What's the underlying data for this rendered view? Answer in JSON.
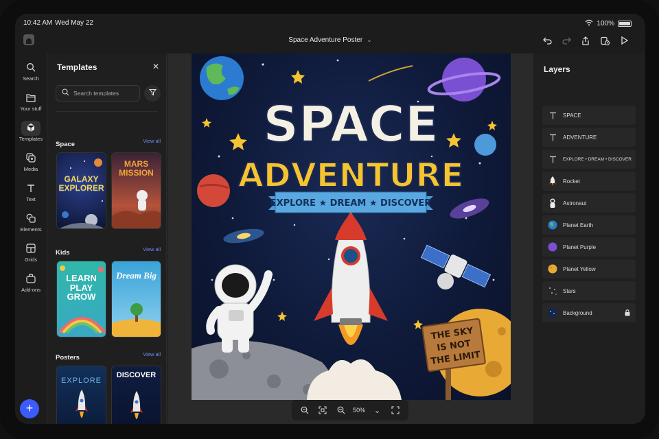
{
  "status": {
    "time": "10:42 AM",
    "date": "Wed May 22",
    "battery": "100%"
  },
  "document": {
    "title": "Space Adventure Poster"
  },
  "rail": [
    {
      "label": "Search",
      "icon": "search-icon"
    },
    {
      "label": "Your stuff",
      "icon": "folder-icon"
    },
    {
      "label": "Templates",
      "icon": "templates-icon"
    },
    {
      "label": "Media",
      "icon": "media-icon"
    },
    {
      "label": "Text",
      "icon": "text-icon"
    },
    {
      "label": "Elements",
      "icon": "elements-icon"
    },
    {
      "label": "Grids",
      "icon": "grids-icon"
    },
    {
      "label": "Add-ons",
      "icon": "addons-icon"
    }
  ],
  "templates": {
    "title": "Templates",
    "search_placeholder": "Search templates",
    "sections": [
      {
        "name": "Space",
        "view_all": "View all",
        "items": [
          {
            "text": "GALAXY EXPLORER"
          },
          {
            "text": "MARS MISSION"
          }
        ]
      },
      {
        "name": "Kids",
        "view_all": "View all",
        "items": [
          {
            "text": "LEARN PLAY GROW"
          },
          {
            "text": "Dream Big"
          }
        ]
      },
      {
        "name": "Posters",
        "view_all": "View all",
        "items": [
          {
            "text": "EXPLORE"
          },
          {
            "text": "DISCOVER"
          }
        ]
      }
    ]
  },
  "poster": {
    "title_line1": "SPACE",
    "title_line2": "ADVENTURE",
    "tagline": "EXPLORE ★ DREAM ★ DISCOVER",
    "sign_text": [
      "THE SKY",
      "IS NOT",
      "THE LIMIT"
    ]
  },
  "zoom": {
    "value": "50%"
  },
  "layers": {
    "title": "Layers",
    "items": [
      {
        "label": "SPACE",
        "icon": "text-icon"
      },
      {
        "label": "ADVENTURE",
        "icon": "text-icon"
      },
      {
        "label": "EXPLORE • DREAM • DISCOVER",
        "icon": "text-icon"
      },
      {
        "label": "Rocket",
        "icon": "rocket-icon"
      },
      {
        "label": "Astronaut",
        "icon": "astronaut-icon"
      },
      {
        "label": "Planet Earth",
        "icon": "planet-earth-icon"
      },
      {
        "label": "Planet Purple",
        "icon": "planet-purple-icon"
      },
      {
        "label": "Planet Yellow",
        "icon": "planet-yellow-icon"
      },
      {
        "label": "Stars",
        "icon": "stars-icon"
      },
      {
        "label": "Background",
        "icon": "background-icon",
        "locked": true
      }
    ]
  },
  "colors": {
    "accent": "#3b5bfb",
    "link": "#6f8cff",
    "title_yellow": "#f6c431",
    "banner_blue": "#4a9bd6"
  }
}
